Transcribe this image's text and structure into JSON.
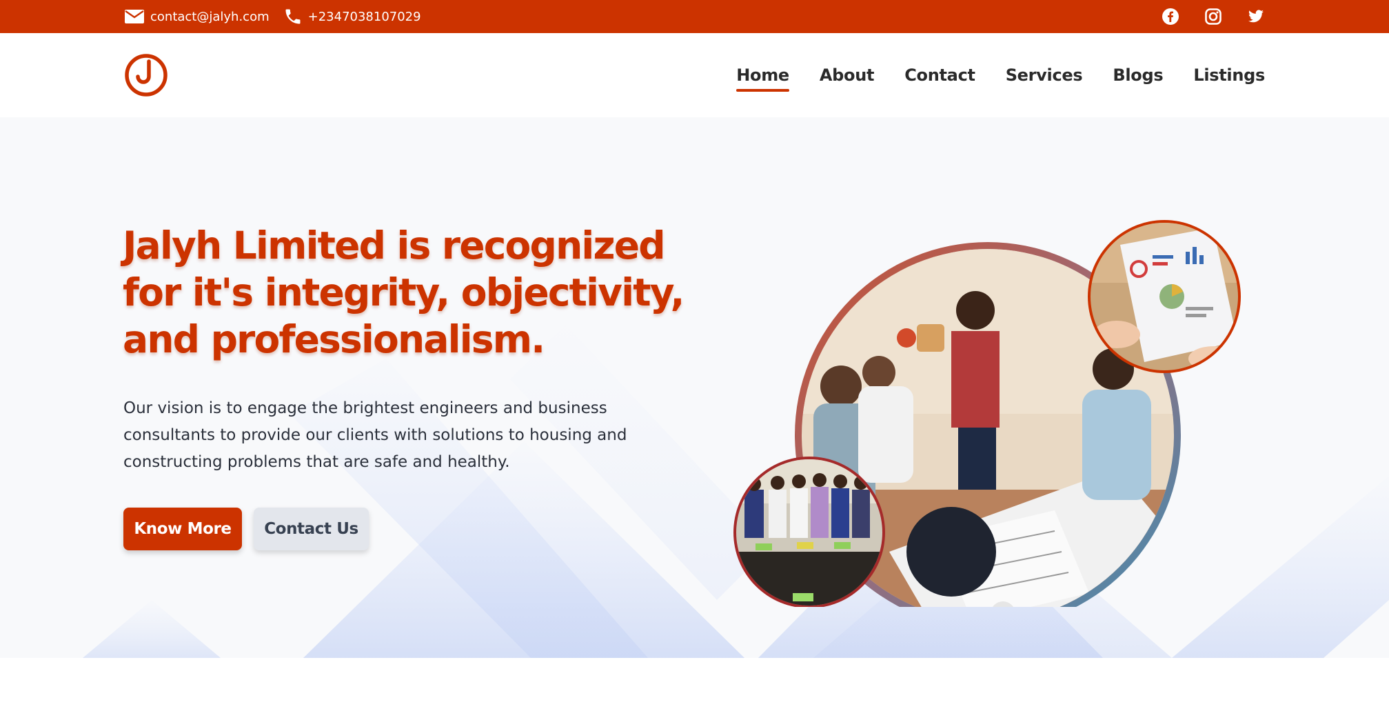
{
  "topbar": {
    "email": "contact@jalyh.com",
    "phone": "+2347038107029",
    "social": [
      "facebook-icon",
      "instagram-icon",
      "twitter-icon"
    ]
  },
  "brand": {
    "logo": "jalyh-logo",
    "accent_color": "#cc3300"
  },
  "nav": {
    "items": [
      {
        "label": "Home",
        "active": true
      },
      {
        "label": "About",
        "active": false
      },
      {
        "label": "Contact",
        "active": false
      },
      {
        "label": "Services",
        "active": false
      },
      {
        "label": "Blogs",
        "active": false
      },
      {
        "label": "Listings",
        "active": false
      }
    ]
  },
  "hero": {
    "headline_lines": [
      "Jalyh Limited is recognized",
      "for it's integrity, objectivity,",
      "and professionalism."
    ],
    "lead_lines": [
      "Our vision is to engage the brightest engineers and business",
      "consultants to provide our clients with solutions to housing and",
      "constructing problems that are safe and healthy."
    ],
    "primary_button": "Know More",
    "secondary_button": "Contact Us",
    "images": [
      "team-meeting-photo",
      "data-report-photo",
      "group-photo"
    ]
  }
}
